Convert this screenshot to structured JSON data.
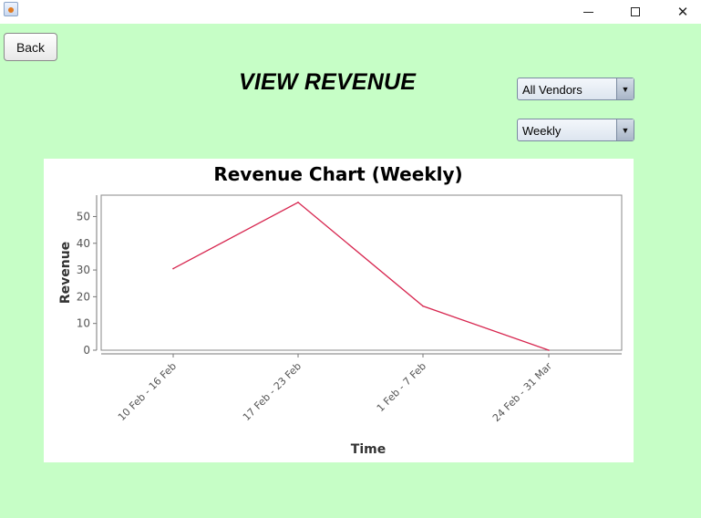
{
  "window": {
    "icon": "java-cup-icon",
    "controls": [
      "minimize-icon",
      "maximize-icon",
      "close-icon"
    ]
  },
  "toolbar": {
    "back_label": "Back"
  },
  "header": {
    "title": "VIEW REVENUE"
  },
  "filters": {
    "vendor": {
      "selected": "All Vendors"
    },
    "period": {
      "selected": "Weekly"
    }
  },
  "colors": {
    "background": "#c6fec6",
    "series": "#d7264f"
  },
  "chart_data": {
    "type": "line",
    "title": "Revenue Chart (Weekly)",
    "xlabel": "Time",
    "ylabel": "Revenue",
    "categories": [
      "10 Feb - 16 Feb",
      "17 Feb - 23 Feb",
      "1 Feb - 7 Feb",
      "24 Feb - 31 Mar"
    ],
    "values": [
      30.5,
      55.3,
      16.5,
      0
    ],
    "ylim": [
      0,
      58
    ],
    "yticks": [
      0,
      10,
      20,
      30,
      40,
      50
    ],
    "grid": false,
    "legend": "none"
  }
}
